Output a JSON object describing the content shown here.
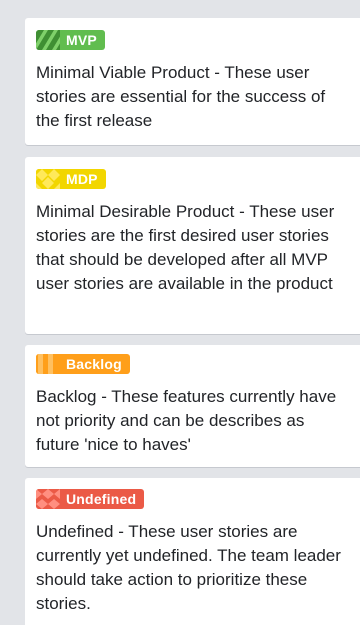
{
  "cards": [
    {
      "label": "MVP",
      "icon": "green-stripes-icon",
      "color": "#61bd4f",
      "description": "Minimal Viable Product - These user stories are essential for the success of the first release"
    },
    {
      "label": "MDP",
      "icon": "yellow-diamonds-icon",
      "color": "#f2d600",
      "description": "Minimal Desirable Product - These user stories are the first desired user stories that should be developed after all MVP user stories are available in the product"
    },
    {
      "label": "Backlog",
      "icon": "orange-bars-icon",
      "color": "#ff9f1a",
      "description": "Backlog - These features currently have not priority and can be describes as future 'nice to haves'"
    },
    {
      "label": "Undefined",
      "icon": "red-checker-icon",
      "color": "#eb5a46",
      "description": "Undefined - These user stories are currently yet undefined. The team leader should take action to prioritize these stories."
    }
  ]
}
